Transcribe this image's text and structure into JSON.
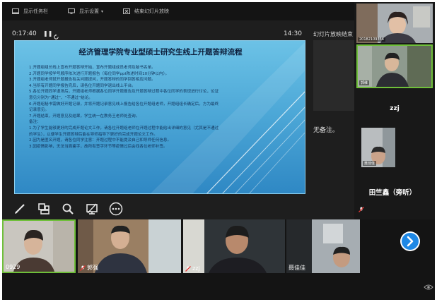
{
  "toolbar": {
    "taskbar_label": "显示任务栏",
    "display_settings_label": "显示设置",
    "end_show_label": "结束幻灯片放映"
  },
  "presenter": {
    "elapsed_time": "0:17:40",
    "current_time": "14:30",
    "next_slide_label": "幻灯片放映结束",
    "notes_text": "无备注。"
  },
  "slide": {
    "title": "经济管理学院专业型硕士研究生线上开题答辩流程",
    "lines": [
      "1.开题组组长线上宣布开题答辩开始，宣布开题组成员老师及秘书名单。",
      "2.开题同学按学号顺序依次进行开题报告（每位同学ppt陈述时间10分钟以内）。",
      "3.开题组老师就开题报告有关问题提问，开题答辩的同学回答相应问题。",
      "4.当所有开题同学报告完后，请各位开题同学退出线上平台。",
      "5.各位开题同学退场后，开题组老师根据各位同学开题报告及开题答辩过程中各位同学的表现进行讨论，论证",
      "意见分别为“通过”、“不通过”结论。",
      "6.开题组秘书需做好开题记录，并将开题记录意见线上报告给各位开题组老师，开题组组长确定后，方为最终",
      "记录意见。",
      "7.开题结束，开题意见及结果，学生统一在教务王老师处查询。",
      "备注：",
      "1.为了学生能够更好的完成开题论文工作，请各位开题组老师在开题过程中能给出详细的意见（尤其是不通过",
      "的学生），以便学生开题答辩后能在导师指导下更好的完成开题论文工作。",
      "2.因为是匿名开题，请各位同学注意：开题过程中不能提及自己和导师任何信息。",
      "3.因疫情影响，无法当面鉴字，故所有签字环节等疫情过后会找各位老师补签。"
    ]
  },
  "side_participants": [
    {
      "name": "20182109354"
    },
    {
      "name": "郭维"
    },
    {
      "name": "zzj"
    },
    {
      "name": "聂佳佳"
    },
    {
      "name": "田竺鑫（旁听）"
    }
  ],
  "bottom_participants": [
    {
      "name": "0929"
    },
    {
      "name": "郭强"
    },
    {
      "name": "zzj"
    },
    {
      "name": "聂佳佳"
    }
  ]
}
